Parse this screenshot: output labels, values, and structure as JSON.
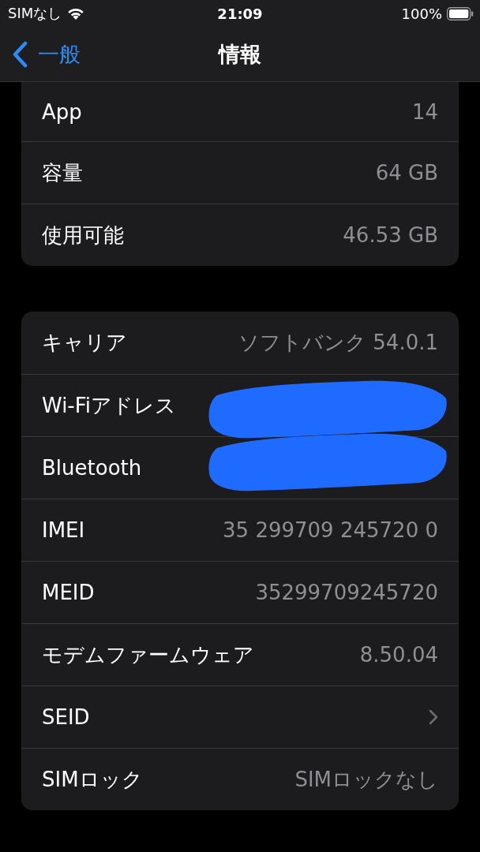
{
  "status_bar": {
    "carrier": "SIMなし",
    "time": "21:09",
    "battery": "100%"
  },
  "nav": {
    "back": "一般",
    "title": "情報"
  },
  "groups": [
    {
      "rows": [
        {
          "kind": "value",
          "label": "App",
          "value": "14"
        },
        {
          "kind": "value",
          "label": "容量",
          "value": "64 GB"
        },
        {
          "kind": "value",
          "label": "使用可能",
          "value": "46.53 GB"
        }
      ]
    },
    {
      "rows": [
        {
          "kind": "value",
          "label": "キャリア",
          "value": "ソフトバンク 54.0.1"
        },
        {
          "kind": "value",
          "label": "Wi-Fiアドレス",
          "redacted": true
        },
        {
          "kind": "value",
          "label": "Bluetooth",
          "redacted": true
        },
        {
          "kind": "value",
          "label": "IMEI",
          "value": "35 299709 245720 0"
        },
        {
          "kind": "value",
          "label": "MEID",
          "value": "35299709245720"
        },
        {
          "kind": "value",
          "label": "モデムファームウェア",
          "value": "8.50.04"
        },
        {
          "kind": "link",
          "label": "SEID"
        },
        {
          "kind": "value",
          "label": "SIMロック",
          "value": "SIMロックなし"
        }
      ]
    }
  ]
}
